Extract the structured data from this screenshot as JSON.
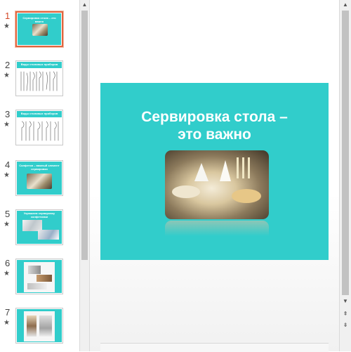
{
  "slides": [
    {
      "number": "1",
      "star": "★",
      "title": "Сервировка стола – это важно"
    },
    {
      "number": "2",
      "star": "★",
      "title": "Виды столовых приборов"
    },
    {
      "number": "3",
      "star": "★",
      "title": "Виды столовых приборов"
    },
    {
      "number": "4",
      "star": "★",
      "title": "Салфетки – важный элемент сервировки"
    },
    {
      "number": "5",
      "star": "★",
      "title": "Украшаем сервировку салфетками"
    },
    {
      "number": "6",
      "star": "★",
      "title": ""
    },
    {
      "number": "7",
      "star": "★",
      "title": ""
    }
  ],
  "active_slide": "1",
  "main_slide": {
    "title_line1": "Сервировка стола –",
    "title_line2": "это важно",
    "background": "#31cdcb"
  },
  "scrollbars": {
    "up_icon": "▲",
    "down_icon": "▼",
    "prev_slide_icon": "⇞",
    "next_slide_icon": "⇟"
  },
  "colors": {
    "accent": "#e0663f",
    "slide_teal": "#31cdcb"
  }
}
